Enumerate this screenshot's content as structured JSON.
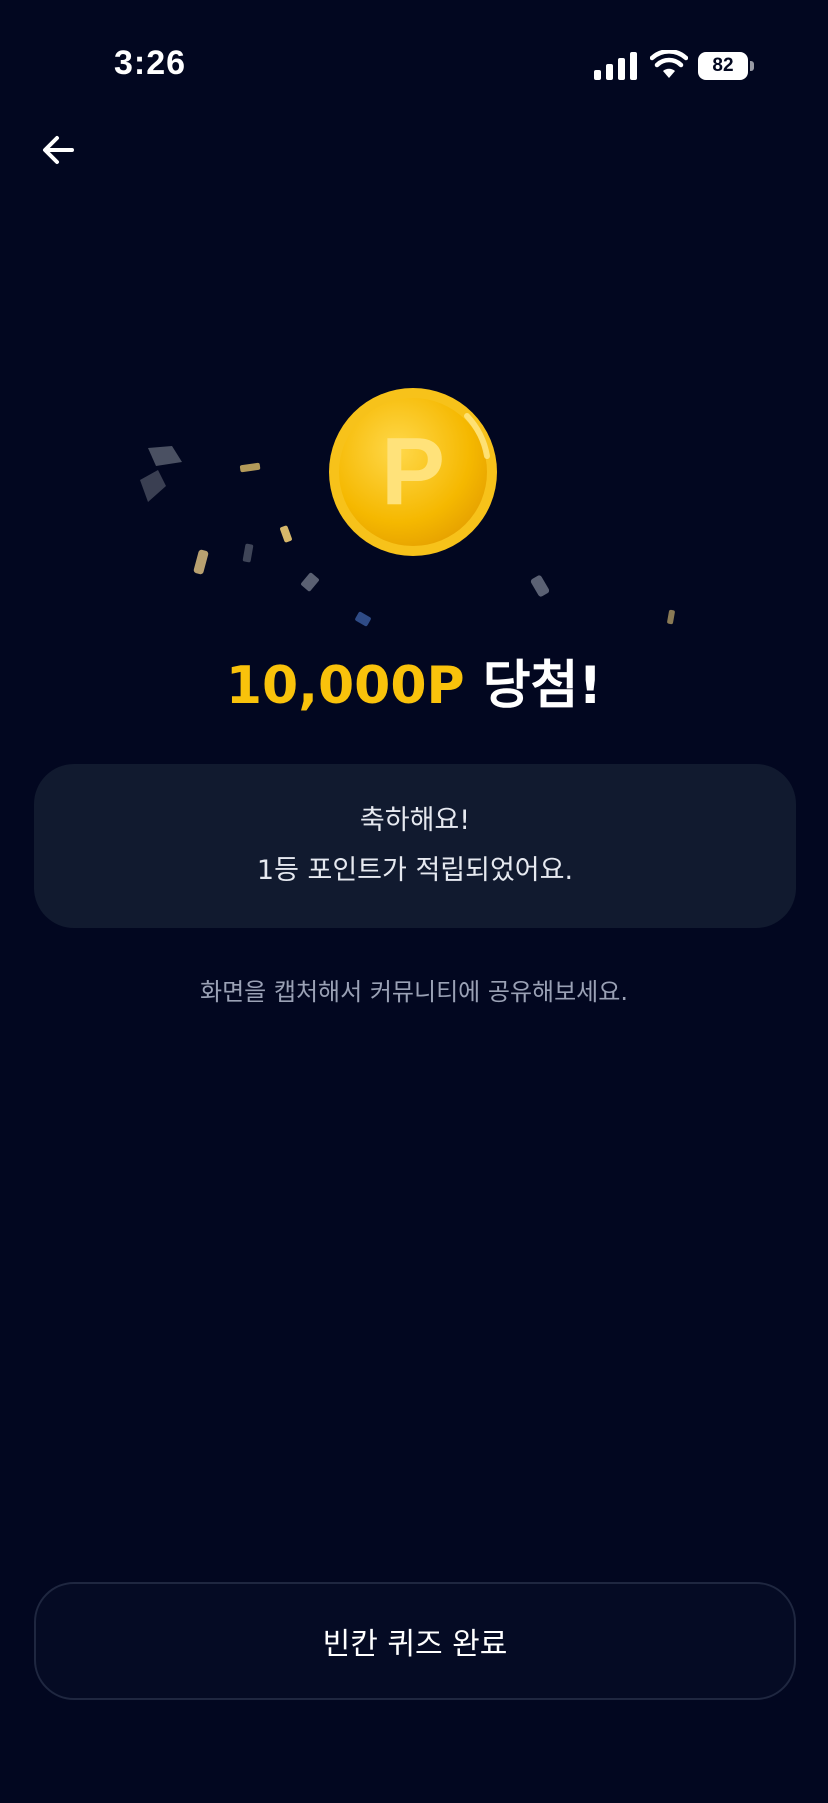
{
  "status_bar": {
    "time": "3:26",
    "battery": "82",
    "icons": [
      "signal-icon",
      "wifi-icon",
      "battery-icon"
    ]
  },
  "nav": {
    "back_icon": "arrow-left-icon"
  },
  "reward": {
    "coin_icon": "point-coin-icon",
    "coin_letter": "P",
    "amount": "10,000P",
    "suffix": " 당첨!",
    "accent_color": "#F9C20B"
  },
  "message": {
    "line1": "축하해요!",
    "line2": "1등 포인트가 적립되었어요."
  },
  "share_hint": "화면을 캡처해서 커뮤니티에 공유해보세요.",
  "button": {
    "label": "빈칸 퀴즈 완료"
  },
  "colors": {
    "background": "#020720",
    "card": "#111A2F",
    "hint_text": "#9AA1B5"
  }
}
